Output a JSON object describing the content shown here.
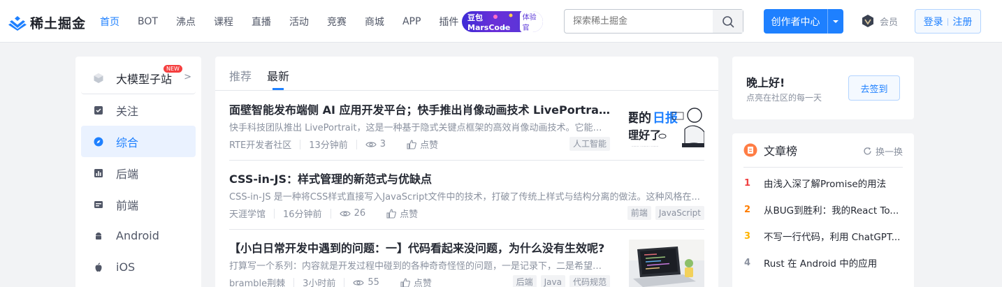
{
  "header": {
    "logo_text": "稀土掘金",
    "nav": [
      {
        "label": "首页",
        "active": true
      },
      {
        "label": "BOT"
      },
      {
        "label": "沸点"
      },
      {
        "label": "课程"
      },
      {
        "label": "直播"
      },
      {
        "label": "活动"
      },
      {
        "label": "竞赛"
      },
      {
        "label": "商城"
      },
      {
        "label": "APP"
      },
      {
        "label": "插件"
      }
    ],
    "promo_text": "豆包MarsCode",
    "promo_badge": "体验官",
    "search_placeholder": "探索稀土掘金",
    "creator_label": "创作者中心",
    "vip_label": "会员",
    "login_label": "登录",
    "register_label": "注册",
    "accent": "#1e80ff"
  },
  "sidebar": {
    "items": [
      {
        "label": "大模型子站",
        "icon": "cube-icon",
        "badge": "NEW"
      },
      {
        "label": "关注",
        "icon": "follow-icon"
      },
      {
        "label": "综合",
        "icon": "compass-icon",
        "active": true
      },
      {
        "label": "后端",
        "icon": "backend-icon"
      },
      {
        "label": "前端",
        "icon": "frontend-icon"
      },
      {
        "label": "Android",
        "icon": "android-icon"
      },
      {
        "label": "iOS",
        "icon": "apple-icon"
      }
    ]
  },
  "feed": {
    "tabs": [
      {
        "label": "推荐"
      },
      {
        "label": "最新",
        "active": true
      }
    ],
    "entries": [
      {
        "title": "面壁智能发布端侧 AI 应用开发平台；快手推出肖像动画技术 LivePortrait...",
        "abstract": "快手科技团队推出 LivePortrait，这是一种基于隐式关键点框架的高效肖像动画技术。它能从...",
        "author": "RTE开发者社区",
        "time": "13分钟前",
        "views": "3",
        "like": "点赞",
        "tags": [
          "人工智能"
        ],
        "thumb": "daily-report"
      },
      {
        "title": "CSS-in-JS：样式管理的新范式与优缺点",
        "abstract": "CSS-in-JS 是一种将CSS样式直接写入JavaScript文件中的技术，打破了传统上样式与结构分离的做法。这种风格在...",
        "author": "天涯学馆",
        "time": "16分钟前",
        "views": "26",
        "like": "点赞",
        "tags": [
          "前端",
          "JavaScript"
        ]
      },
      {
        "title": "【小白日常开发中遇到的问题：一】代码看起来没问题，为什么没有生效呢?",
        "abstract": "打算写一个系列：内容就是开发过程中碰到的各种奇奇怪怪的问题，一是记录下，二是希望对...",
        "author": "bramble荆棘",
        "time": "3小时前",
        "views": "55",
        "like": "点赞",
        "tags": [
          "后端",
          "Java",
          "代码规范"
        ],
        "thumb": "laptop"
      }
    ]
  },
  "signin": {
    "greeting": "晚上好!",
    "subtitle": "点亮在社区的每一天",
    "button": "去签到"
  },
  "rank": {
    "title": "文章榜",
    "refresh": "换一换",
    "items": [
      {
        "num": "1",
        "text": "由浅入深了解Promise的用法",
        "color": "#f04142"
      },
      {
        "num": "2",
        "text": "从BUG到胜利：我的React To...",
        "color": "#ff7d00"
      },
      {
        "num": "3",
        "text": "不写一行代码，利用 ChatGPT...",
        "color": "#ffb400"
      },
      {
        "num": "4",
        "text": "Rust 在 Android 中的应用",
        "color": "#8a919f"
      }
    ]
  }
}
